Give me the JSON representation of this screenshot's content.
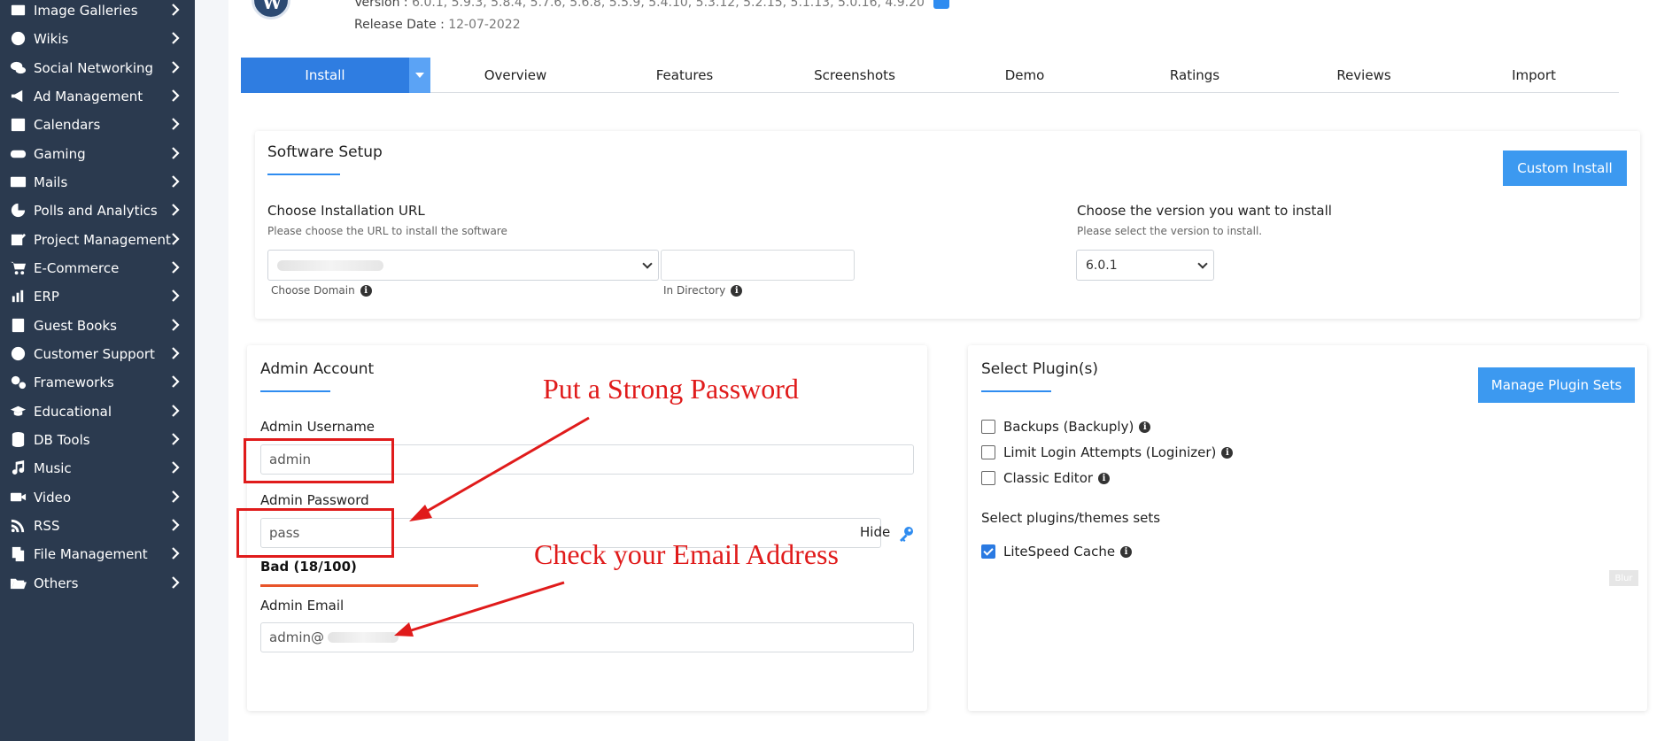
{
  "sidebar": {
    "items": [
      {
        "label": "Image Galleries",
        "icon": "image-icon"
      },
      {
        "label": "Wikis",
        "icon": "globe-icon"
      },
      {
        "label": "Social Networking",
        "icon": "chat-bubbles-icon"
      },
      {
        "label": "Ad Management",
        "icon": "megaphone-icon"
      },
      {
        "label": "Calendars",
        "icon": "calendar-icon"
      },
      {
        "label": "Gaming",
        "icon": "gamepad-icon"
      },
      {
        "label": "Mails",
        "icon": "envelope-icon"
      },
      {
        "label": "Polls and Analytics",
        "icon": "pie-chart-icon"
      },
      {
        "label": "Project Management",
        "icon": "edit-icon"
      },
      {
        "label": "E-Commerce",
        "icon": "cart-icon"
      },
      {
        "label": "ERP",
        "icon": "bar-chart-icon"
      },
      {
        "label": "Guest Books",
        "icon": "book-icon"
      },
      {
        "label": "Customer Support",
        "icon": "lifebuoy-icon"
      },
      {
        "label": "Frameworks",
        "icon": "cogs-icon"
      },
      {
        "label": "Educational",
        "icon": "graduation-cap-icon"
      },
      {
        "label": "DB Tools",
        "icon": "database-icon"
      },
      {
        "label": "Music",
        "icon": "music-icon"
      },
      {
        "label": "Video",
        "icon": "video-icon"
      },
      {
        "label": "RSS",
        "icon": "rss-icon"
      },
      {
        "label": "File Management",
        "icon": "files-icon"
      },
      {
        "label": "Others",
        "icon": "folder-open-icon"
      }
    ]
  },
  "header": {
    "version_label": "Version :",
    "version_value": "6.0.1, 5.9.3, 5.8.4, 5.7.6, 5.6.8, 5.5.9, 5.4.10, 5.3.12, 5.2.15, 5.1.13, 5.0.16, 4.9.20",
    "release_label": "Release Date :",
    "release_value": "12-07-2022"
  },
  "tabs": {
    "install": "Install",
    "items": [
      "Overview",
      "Features",
      "Screenshots",
      "Demo",
      "Ratings",
      "Reviews",
      "Import"
    ]
  },
  "software_setup": {
    "title": "Software Setup",
    "custom_install": "Custom Install",
    "url_title": "Choose Installation URL",
    "url_sub": "Please choose the URL to install the software",
    "choose_domain": "Choose Domain",
    "in_directory": "In Directory",
    "directory_value": "",
    "version_title": "Choose the version you want to install",
    "version_sub": "Please select the version to install.",
    "version_selected": "6.0.1"
  },
  "admin_account": {
    "title": "Admin Account",
    "username_label": "Admin Username",
    "username_value": "admin",
    "password_label": "Admin Password",
    "password_value": "pass",
    "hide_label": "Hide",
    "strength_text": "Bad (18/100)",
    "strength_value": 0.18,
    "email_label": "Admin Email",
    "email_value": "admin@"
  },
  "plugins": {
    "title": "Select Plugin(s)",
    "manage_button": "Manage Plugin Sets",
    "items": [
      {
        "label": "Backups (Backuply)",
        "checked": false
      },
      {
        "label": "Limit Login Attempts (Loginizer)",
        "checked": false
      },
      {
        "label": "Classic Editor",
        "checked": false
      }
    ],
    "sets_title": "Select plugins/themes sets",
    "sets": [
      {
        "label": "LiteSpeed Cache",
        "checked": true
      }
    ],
    "blur_tag": "Blur"
  },
  "annotations": {
    "password_note": "Put a Strong Password",
    "email_note": "Check your Email Address"
  },
  "colors": {
    "sidebar_bg": "#2b3a4f",
    "accent": "#2f7de1",
    "annotation_red": "#e01b1b",
    "strength_bar": "#e8542a"
  }
}
